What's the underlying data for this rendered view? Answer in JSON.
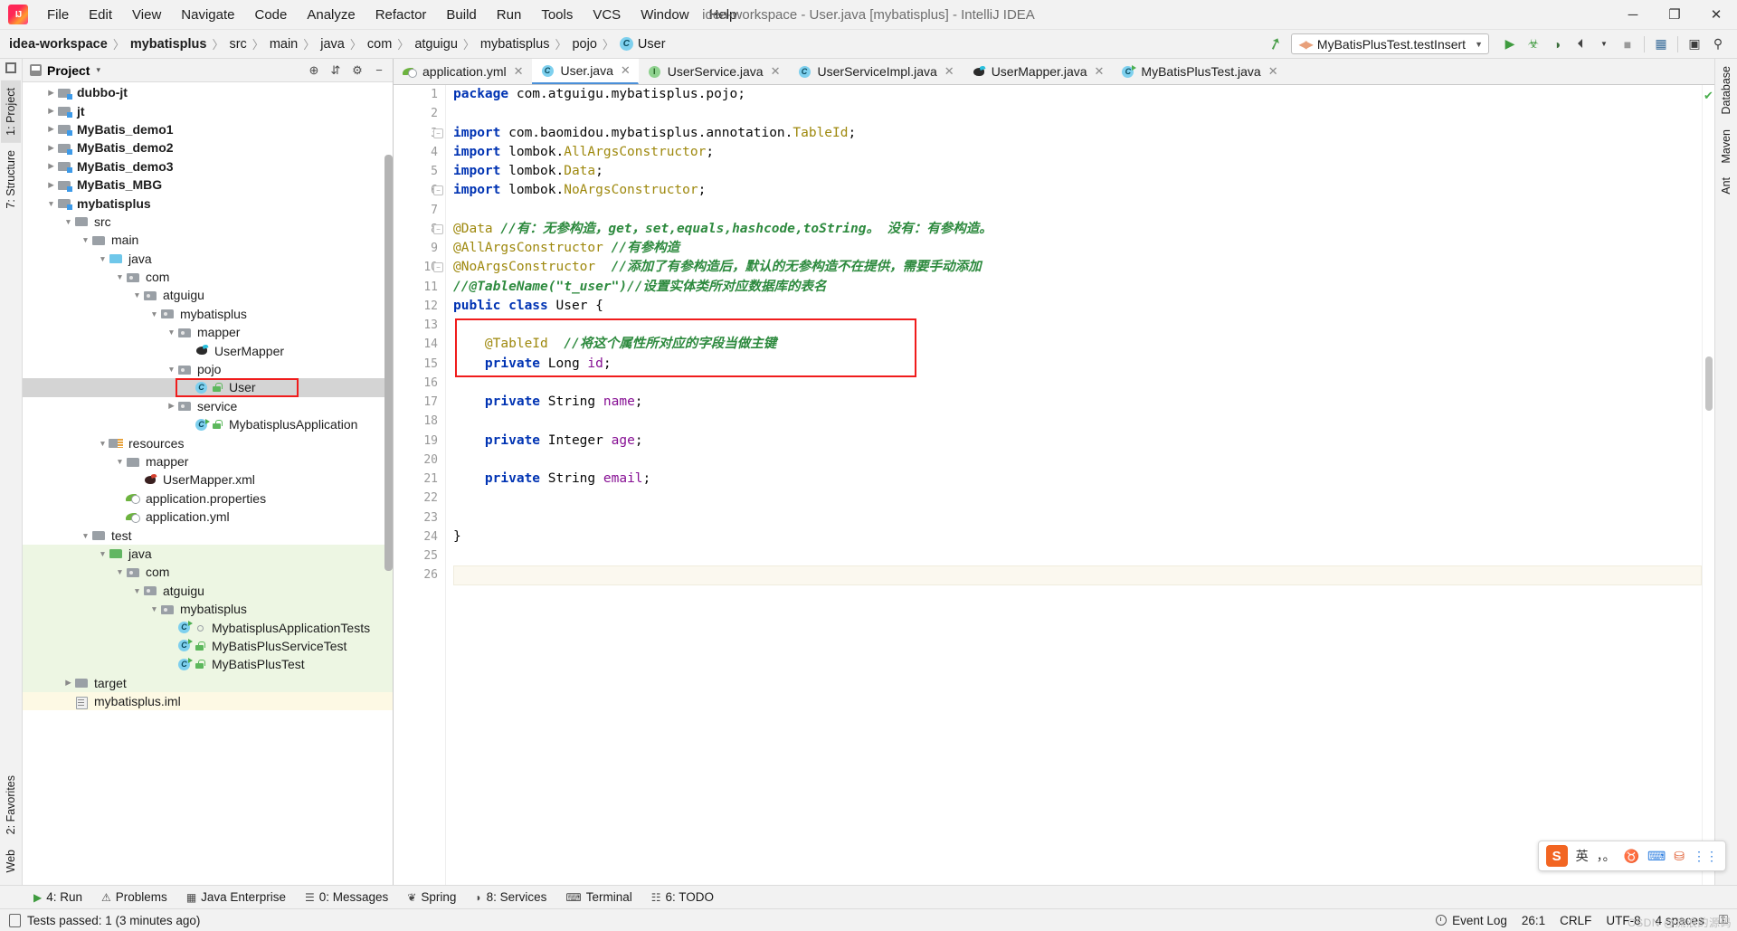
{
  "window": {
    "title": "idea-workspace - User.java [mybatisplus] - IntelliJ IDEA",
    "minimize": "─",
    "maximize": "❐",
    "close": "✕"
  },
  "menu": {
    "items": [
      "File",
      "Edit",
      "View",
      "Navigate",
      "Code",
      "Analyze",
      "Refactor",
      "Build",
      "Run",
      "Tools",
      "VCS",
      "Window",
      "Help"
    ]
  },
  "breadcrumb": {
    "items": [
      "idea-workspace",
      "mybatisplus",
      "src",
      "main",
      "java",
      "com",
      "atguigu",
      "mybatisplus",
      "pojo"
    ],
    "file": "User",
    "separator": "〉"
  },
  "toolbar": {
    "run_config": "MyBatisPlusTest.testInsert",
    "dropdown_arrow": "▼",
    "buttons": [
      {
        "name": "build-hammer",
        "glyph": "⚑"
      },
      {
        "name": "run",
        "glyph": "▶"
      },
      {
        "name": "debug",
        "glyph": "☸"
      },
      {
        "name": "run-with-coverage",
        "glyph": "◑"
      },
      {
        "name": "profiler",
        "glyph": "◴"
      },
      {
        "name": "stop",
        "glyph": "■"
      },
      {
        "name": "update-project",
        "glyph": "❐"
      },
      {
        "name": "select-opened-file",
        "glyph": "▣"
      },
      {
        "name": "search-everywhere",
        "glyph": "⚲"
      }
    ]
  },
  "left_strip": {
    "tabs": [
      "1: Project",
      "7: Structure",
      "2: Favorites",
      "Web"
    ]
  },
  "right_strip": {
    "tabs": [
      "Database",
      "Maven",
      "Ant"
    ]
  },
  "project_panel": {
    "title": "Project",
    "title_arrow": "▾",
    "header_buttons": [
      {
        "name": "locate-icon",
        "glyph": "⊕"
      },
      {
        "name": "collapse-all-icon",
        "glyph": "⇵"
      },
      {
        "name": "settings-gear-icon",
        "glyph": "⚙"
      },
      {
        "name": "hide-icon",
        "glyph": "−"
      }
    ],
    "tree": [
      {
        "label": "dubbo-jt",
        "indent": 1,
        "arrow": "closed",
        "icon": "module",
        "bold": true
      },
      {
        "label": "jt",
        "indent": 1,
        "arrow": "closed",
        "icon": "module",
        "bold": true
      },
      {
        "label": "MyBatis_demo1",
        "indent": 1,
        "arrow": "closed",
        "icon": "module",
        "bold": true
      },
      {
        "label": "MyBatis_demo2",
        "indent": 1,
        "arrow": "closed",
        "icon": "module",
        "bold": true
      },
      {
        "label": "MyBatis_demo3",
        "indent": 1,
        "arrow": "closed",
        "icon": "module",
        "bold": true
      },
      {
        "label": "MyBatis_MBG",
        "indent": 1,
        "arrow": "closed",
        "icon": "module",
        "bold": true
      },
      {
        "label": "mybatisplus",
        "indent": 1,
        "arrow": "open",
        "icon": "module",
        "bold": true
      },
      {
        "label": "src",
        "indent": 2,
        "arrow": "open",
        "icon": "folder"
      },
      {
        "label": "main",
        "indent": 3,
        "arrow": "open",
        "icon": "folder"
      },
      {
        "label": "java",
        "indent": 4,
        "arrow": "open",
        "icon": "folderblue"
      },
      {
        "label": "com",
        "indent": 5,
        "arrow": "open",
        "icon": "pkg"
      },
      {
        "label": "atguigu",
        "indent": 6,
        "arrow": "open",
        "icon": "pkg"
      },
      {
        "label": "mybatisplus",
        "indent": 7,
        "arrow": "open",
        "icon": "pkg"
      },
      {
        "label": "mapper",
        "indent": 8,
        "arrow": "open",
        "icon": "pkg"
      },
      {
        "label": "UserMapper",
        "indent": 9,
        "arrow": "none",
        "icon": "bird"
      },
      {
        "label": "pojo",
        "indent": 8,
        "arrow": "open",
        "icon": "pkg"
      },
      {
        "label": "User",
        "indent": 9,
        "arrow": "none",
        "icon": "cls",
        "badge": "lock",
        "selected": true,
        "highlight": true
      },
      {
        "label": "service",
        "indent": 8,
        "arrow": "closed",
        "icon": "pkg"
      },
      {
        "label": "MybatisplusApplication",
        "indent": 9,
        "arrow": "none",
        "icon": "spring",
        "badge": "lock"
      },
      {
        "label": "resources",
        "indent": 4,
        "arrow": "open",
        "icon": "res"
      },
      {
        "label": "mapper",
        "indent": 5,
        "arrow": "open",
        "icon": "folder"
      },
      {
        "label": "UserMapper.xml",
        "indent": 6,
        "arrow": "none",
        "icon": "birdx"
      },
      {
        "label": "application.properties",
        "indent": 5,
        "arrow": "none",
        "icon": "leaf"
      },
      {
        "label": "application.yml",
        "indent": 5,
        "arrow": "none",
        "icon": "leaf"
      },
      {
        "label": "test",
        "indent": 3,
        "arrow": "open",
        "icon": "folder"
      },
      {
        "label": "java",
        "indent": 4,
        "arrow": "open",
        "icon": "foldergreen",
        "bg": "test"
      },
      {
        "label": "com",
        "indent": 5,
        "arrow": "open",
        "icon": "pkg",
        "bg": "test"
      },
      {
        "label": "atguigu",
        "indent": 6,
        "arrow": "open",
        "icon": "pkg",
        "bg": "test"
      },
      {
        "label": "mybatisplus",
        "indent": 7,
        "arrow": "open",
        "icon": "pkg",
        "bg": "test"
      },
      {
        "label": "MybatisplusApplicationTests",
        "indent": 8,
        "arrow": "none",
        "icon": "clsrun",
        "badge": "dot",
        "bg": "test"
      },
      {
        "label": "MyBatisPlusServiceTest",
        "indent": 8,
        "arrow": "none",
        "icon": "clsrun",
        "badge": "lock",
        "bg": "test"
      },
      {
        "label": "MyBatisPlusTest",
        "indent": 8,
        "arrow": "none",
        "icon": "clsrun",
        "badge": "lock",
        "bg": "test"
      },
      {
        "label": "target",
        "indent": 2,
        "arrow": "closed",
        "icon": "folder",
        "bg": "target"
      },
      {
        "label": "mybatisplus.iml",
        "indent": 2,
        "arrow": "none",
        "icon": "iml",
        "bg": "yml"
      }
    ]
  },
  "editor": {
    "tabs": [
      {
        "label": "application.yml",
        "icon": "leaf",
        "active": false,
        "close": "✕"
      },
      {
        "label": "User.java",
        "icon": "cls",
        "active": true,
        "close": "✕"
      },
      {
        "label": "UserService.java",
        "icon": "iface",
        "active": false,
        "close": "✕"
      },
      {
        "label": "UserServiceImpl.java",
        "icon": "cls",
        "active": false,
        "close": "✕"
      },
      {
        "label": "UserMapper.java",
        "icon": "bird",
        "active": false,
        "close": "✕"
      },
      {
        "label": "MyBatisPlusTest.java",
        "icon": "clsrun",
        "active": false,
        "close": "✕"
      }
    ],
    "line_count": 26,
    "caret_line": 26,
    "lines": [
      {
        "n": 1,
        "tokens": [
          {
            "t": "package ",
            "c": "kw"
          },
          {
            "t": "com.atguigu.mybatisplus.pojo;",
            "c": "pln"
          }
        ]
      },
      {
        "n": 2,
        "tokens": []
      },
      {
        "n": 3,
        "fold": "minus",
        "tokens": [
          {
            "t": "import ",
            "c": "kw"
          },
          {
            "t": "com.baomidou.mybatisplus.annotation.",
            "c": "pln"
          },
          {
            "t": "TableId",
            "c": "ann"
          },
          {
            "t": ";",
            "c": "pln"
          }
        ]
      },
      {
        "n": 4,
        "tokens": [
          {
            "t": "import ",
            "c": "kw"
          },
          {
            "t": "lombok.",
            "c": "pln"
          },
          {
            "t": "AllArgsConstructor",
            "c": "ann"
          },
          {
            "t": ";",
            "c": "pln"
          }
        ]
      },
      {
        "n": 5,
        "tokens": [
          {
            "t": "import ",
            "c": "kw"
          },
          {
            "t": "lombok.",
            "c": "pln"
          },
          {
            "t": "Data",
            "c": "ann"
          },
          {
            "t": ";",
            "c": "pln"
          }
        ]
      },
      {
        "n": 6,
        "fold": "minus",
        "tokens": [
          {
            "t": "import ",
            "c": "kw"
          },
          {
            "t": "lombok.",
            "c": "pln"
          },
          {
            "t": "NoArgsConstructor",
            "c": "ann"
          },
          {
            "t": ";",
            "c": "pln"
          }
        ]
      },
      {
        "n": 7,
        "tokens": []
      },
      {
        "n": 8,
        "fold": "minus",
        "tokens": [
          {
            "t": "@Data ",
            "c": "ann"
          },
          {
            "t": "//有：无参构造，get，set,equals,hashcode,toString。 没有：有参构造。",
            "c": "cm"
          }
        ]
      },
      {
        "n": 9,
        "tokens": [
          {
            "t": "@AllArgsConstructor ",
            "c": "ann"
          },
          {
            "t": "//有参构造",
            "c": "cm"
          }
        ]
      },
      {
        "n": 10,
        "fold": "minus",
        "tokens": [
          {
            "t": "@NoArgsConstructor  ",
            "c": "ann"
          },
          {
            "t": "//添加了有参构造后，默认的无参构造不在提供，需要手动添加",
            "c": "cm"
          }
        ]
      },
      {
        "n": 11,
        "tokens": [
          {
            "t": "//@TableName(\"t_user\")//设置实体类所对应数据库的表名",
            "c": "cm"
          }
        ]
      },
      {
        "n": 12,
        "tokens": [
          {
            "t": "public ",
            "c": "kw"
          },
          {
            "t": "class ",
            "c": "kw"
          },
          {
            "t": "User {",
            "c": "pln"
          }
        ]
      },
      {
        "n": 13,
        "tokens": []
      },
      {
        "n": 14,
        "indent": 4,
        "tokens": [
          {
            "t": "@TableId  ",
            "c": "ann"
          },
          {
            "t": "//将这个属性所对应的字段当做主键",
            "c": "cm"
          }
        ]
      },
      {
        "n": 15,
        "indent": 4,
        "tokens": [
          {
            "t": "private ",
            "c": "kw"
          },
          {
            "t": "Long ",
            "c": "pln"
          },
          {
            "t": "id",
            "c": "fld"
          },
          {
            "t": ";",
            "c": "pln"
          }
        ]
      },
      {
        "n": 16,
        "tokens": []
      },
      {
        "n": 17,
        "indent": 4,
        "tokens": [
          {
            "t": "private ",
            "c": "kw"
          },
          {
            "t": "String ",
            "c": "pln"
          },
          {
            "t": "name",
            "c": "fld"
          },
          {
            "t": ";",
            "c": "pln"
          }
        ]
      },
      {
        "n": 18,
        "tokens": []
      },
      {
        "n": 19,
        "indent": 4,
        "tokens": [
          {
            "t": "private ",
            "c": "kw"
          },
          {
            "t": "Integer ",
            "c": "pln"
          },
          {
            "t": "age",
            "c": "fld"
          },
          {
            "t": ";",
            "c": "pln"
          }
        ]
      },
      {
        "n": 20,
        "tokens": []
      },
      {
        "n": 21,
        "indent": 4,
        "tokens": [
          {
            "t": "private ",
            "c": "kw"
          },
          {
            "t": "String ",
            "c": "pln"
          },
          {
            "t": "email",
            "c": "fld"
          },
          {
            "t": ";",
            "c": "pln"
          }
        ]
      },
      {
        "n": 22,
        "tokens": []
      },
      {
        "n": 23,
        "tokens": []
      },
      {
        "n": 24,
        "tokens": [
          {
            "t": "}",
            "c": "pln"
          }
        ]
      },
      {
        "n": 25,
        "tokens": []
      },
      {
        "n": 26,
        "tokens": [],
        "caret": true
      }
    ],
    "inspection_status": "✔"
  },
  "ime": {
    "logo": "S",
    "lang": "英",
    "punct": "，。",
    "mic": "♉",
    "keyboard": "⌨",
    "toolbox": "⛁",
    "menu": "⋮⋮"
  },
  "bottom_tools": [
    {
      "label": "4: Run",
      "underline": "4",
      "icon": "▶"
    },
    {
      "label": "Problems",
      "underline": "",
      "icon": "⚠"
    },
    {
      "label": "Java Enterprise",
      "underline": "",
      "icon": "▦"
    },
    {
      "label": "0: Messages",
      "underline": "0",
      "icon": "☰"
    },
    {
      "label": "Spring",
      "underline": "",
      "icon": "❦"
    },
    {
      "label": "8: Services",
      "underline": "8",
      "icon": "◗"
    },
    {
      "label": "Terminal",
      "underline": "",
      "icon": "⌨"
    },
    {
      "label": "6: TODO",
      "underline": "6",
      "icon": "☷"
    }
  ],
  "status": {
    "message": "Tests passed: 1 (3 minutes ago)",
    "caret_position": "26:1",
    "line_separator": "CRLF",
    "encoding": "UTF-8",
    "indent": "4 spaces",
    "event_log": "Event Log",
    "lock": "⚿",
    "watermark": "CSDN @流浪的源码"
  }
}
